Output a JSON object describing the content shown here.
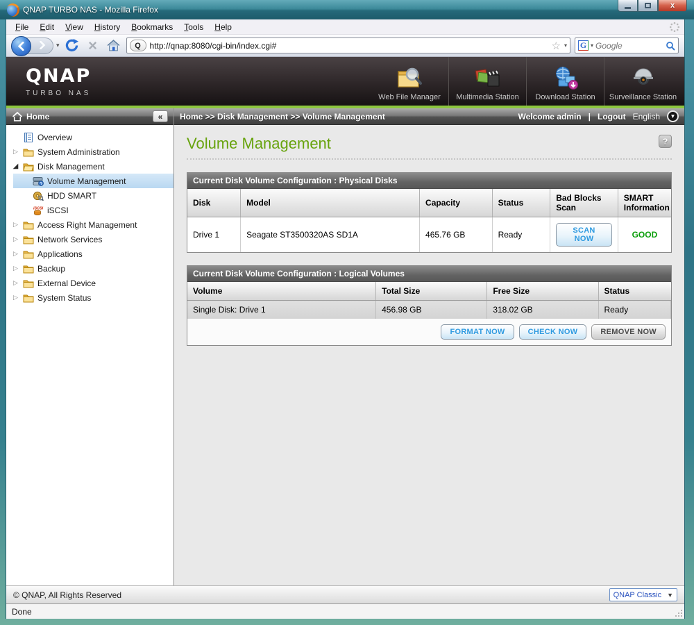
{
  "window": {
    "title": "QNAP TURBO NAS - Mozilla Firefox"
  },
  "menubar": {
    "items": [
      "File",
      "Edit",
      "View",
      "History",
      "Bookmarks",
      "Tools",
      "Help"
    ]
  },
  "navbar": {
    "url": "http://qnap:8080/cgi-bin/index.cgi#",
    "favicon_letter": "Q",
    "search_placeholder": "Google",
    "search_engine_letter": "G",
    "star_glyph": "☆",
    "caret_glyph": "▾",
    "stop_glyph": "×"
  },
  "brand": {
    "logo": "QNAP",
    "tagline": "TURBO NAS"
  },
  "stations": [
    {
      "label": "Web File Manager",
      "icon": "web-file-manager-icon"
    },
    {
      "label": "Multimedia Station",
      "icon": "multimedia-station-icon"
    },
    {
      "label": "Download Station",
      "icon": "download-station-icon"
    },
    {
      "label": "Surveillance Station",
      "icon": "surveillance-station-icon"
    }
  ],
  "sidebar": {
    "header": "Home",
    "collapse_glyph": "«",
    "items": [
      {
        "label": "Overview",
        "icon": "document",
        "level": 1,
        "expander": "none",
        "selected": false
      },
      {
        "label": "System Administration",
        "icon": "folder",
        "level": 1,
        "expander": "closed",
        "selected": false
      },
      {
        "label": "Disk Management",
        "icon": "folder-open",
        "level": 1,
        "expander": "open",
        "selected": false
      },
      {
        "label": "Volume Management",
        "icon": "volume",
        "level": 2,
        "expander": "none",
        "selected": true
      },
      {
        "label": "HDD SMART",
        "icon": "hdd-smart",
        "level": 2,
        "expander": "none",
        "selected": false
      },
      {
        "label": "iSCSI",
        "icon": "iscsi",
        "level": 2,
        "expander": "none",
        "selected": false
      },
      {
        "label": "Access Right Management",
        "icon": "folder",
        "level": 1,
        "expander": "closed",
        "selected": false
      },
      {
        "label": "Network Services",
        "icon": "folder",
        "level": 1,
        "expander": "closed",
        "selected": false
      },
      {
        "label": "Applications",
        "icon": "folder",
        "level": 1,
        "expander": "closed",
        "selected": false
      },
      {
        "label": "Backup",
        "icon": "folder",
        "level": 1,
        "expander": "closed",
        "selected": false
      },
      {
        "label": "External Device",
        "icon": "folder",
        "level": 1,
        "expander": "closed",
        "selected": false
      },
      {
        "label": "System Status",
        "icon": "folder",
        "level": 1,
        "expander": "closed",
        "selected": false
      }
    ],
    "expander_closed_glyph": "▷",
    "expander_open_glyph": "◢"
  },
  "breadcrumb": {
    "path": "Home >> Disk Management >> Volume Management",
    "welcome": "Welcome admin",
    "separator": "|",
    "logout": "Logout",
    "language": "English",
    "language_caret": "▼"
  },
  "page": {
    "title": "Volume Management",
    "help_glyph": "?"
  },
  "physical_table": {
    "title": "Current Disk Volume Configuration : Physical Disks",
    "columns": [
      "Disk",
      "Model",
      "Capacity",
      "Status",
      "Bad Blocks Scan",
      "SMART Information"
    ],
    "row": {
      "disk": "Drive 1",
      "model": "Seagate ST3500320AS SD1A",
      "capacity": "465.76 GB",
      "status": "Ready",
      "scan_label": "SCAN NOW",
      "smart": "GOOD"
    }
  },
  "logical_table": {
    "title": "Current Disk Volume Configuration : Logical Volumes",
    "columns": [
      "Volume",
      "Total Size",
      "Free Size",
      "Status"
    ],
    "row": {
      "volume": "Single Disk: Drive 1",
      "total": "456.98 GB",
      "free": "318.02 GB",
      "status": "Ready"
    },
    "actions": [
      "FORMAT NOW",
      "CHECK NOW",
      "REMOVE NOW"
    ]
  },
  "footer": {
    "copyright": "© QNAP, All Rights Reserved",
    "theme": "QNAP Classic",
    "theme_caret": "▼"
  },
  "statusbar": {
    "text": "Done"
  },
  "colors": {
    "brand_green_bar": "#8dc63f",
    "page_title_green": "#67a30d",
    "smart_good_green": "#0a9e0a",
    "action_button_blue": "#2e9ae0",
    "tree_selection_blue": "#b9d8f1",
    "titlebar_teal": "#3d8a9a"
  }
}
